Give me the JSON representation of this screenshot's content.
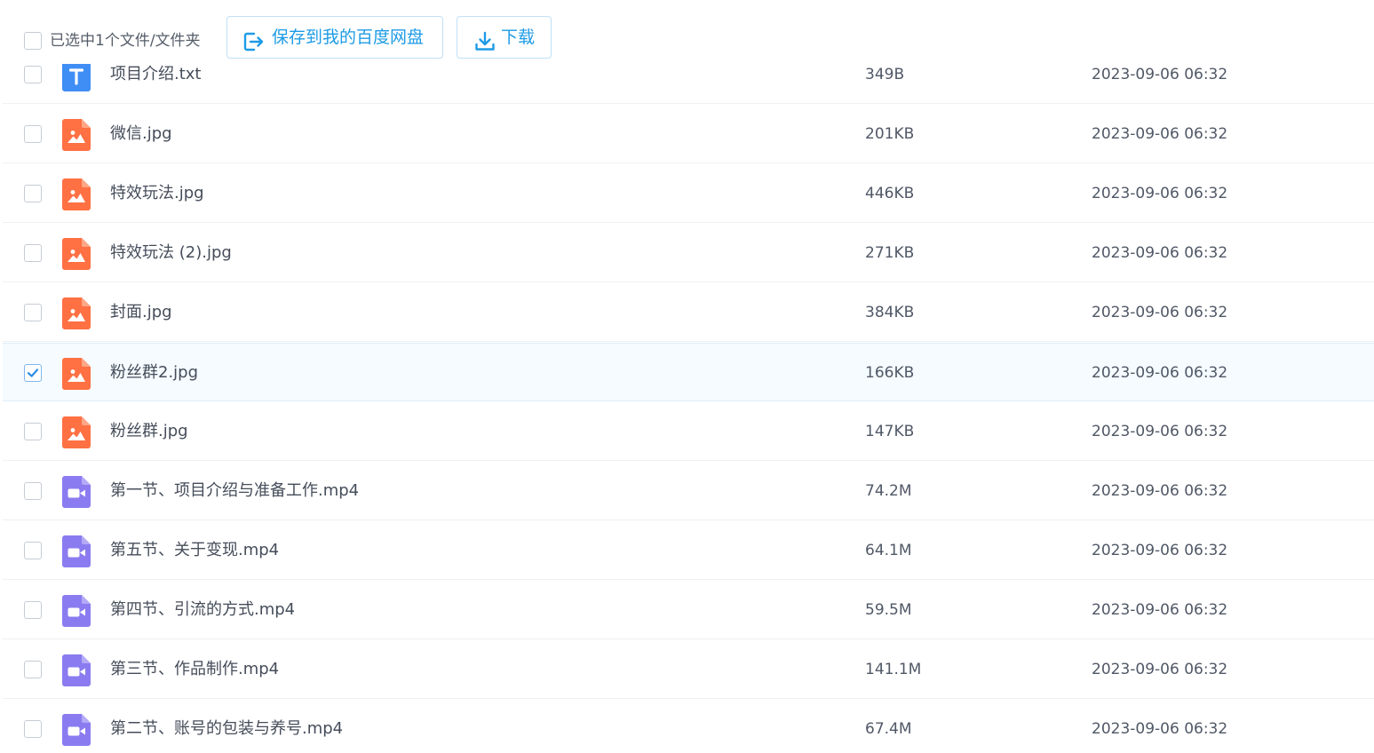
{
  "toolbar": {
    "selection_text": "已选中1个文件/文件夹",
    "save_label": "保存到我的百度网盘",
    "download_label": "下载",
    "accent_color": "#1e9be6"
  },
  "files": [
    {
      "name": "项目介绍.txt",
      "size": "349B",
      "date": "2023-09-06 06:32",
      "type": "txt",
      "icon": "text-file-icon",
      "checked": false
    },
    {
      "name": "微信.jpg",
      "size": "201KB",
      "date": "2023-09-06 06:32",
      "type": "image",
      "icon": "image-file-icon",
      "checked": false
    },
    {
      "name": "特效玩法.jpg",
      "size": "446KB",
      "date": "2023-09-06 06:32",
      "type": "image",
      "icon": "image-file-icon",
      "checked": false
    },
    {
      "name": "特效玩法 (2).jpg",
      "size": "271KB",
      "date": "2023-09-06 06:32",
      "type": "image",
      "icon": "image-file-icon",
      "checked": false
    },
    {
      "name": "封面.jpg",
      "size": "384KB",
      "date": "2023-09-06 06:32",
      "type": "image",
      "icon": "image-file-icon",
      "checked": false
    },
    {
      "name": "粉丝群2.jpg",
      "size": "166KB",
      "date": "2023-09-06 06:32",
      "type": "image",
      "icon": "image-file-icon",
      "checked": true
    },
    {
      "name": "粉丝群.jpg",
      "size": "147KB",
      "date": "2023-09-06 06:32",
      "type": "image",
      "icon": "image-file-icon",
      "checked": false
    },
    {
      "name": "第一节、项目介绍与准备工作.mp4",
      "size": "74.2M",
      "date": "2023-09-06 06:32",
      "type": "video",
      "icon": "video-file-icon",
      "checked": false
    },
    {
      "name": "第五节、关于变现.mp4",
      "size": "64.1M",
      "date": "2023-09-06 06:32",
      "type": "video",
      "icon": "video-file-icon",
      "checked": false
    },
    {
      "name": "第四节、引流的方式.mp4",
      "size": "59.5M",
      "date": "2023-09-06 06:32",
      "type": "video",
      "icon": "video-file-icon",
      "checked": false
    },
    {
      "name": "第三节、作品制作.mp4",
      "size": "141.1M",
      "date": "2023-09-06 06:32",
      "type": "video",
      "icon": "video-file-icon",
      "checked": false
    },
    {
      "name": "第二节、账号的包装与养号.mp4",
      "size": "67.4M",
      "date": "2023-09-06 06:32",
      "type": "video",
      "icon": "video-file-icon",
      "checked": false
    }
  ],
  "colors": {
    "txt_icon": "#3f8ef5",
    "image_icon": "#ff7043",
    "video_icon": "#8a7cf0",
    "selected_row_bg": "#f5fbff",
    "checkbox_checked": "#2a8ee6"
  }
}
